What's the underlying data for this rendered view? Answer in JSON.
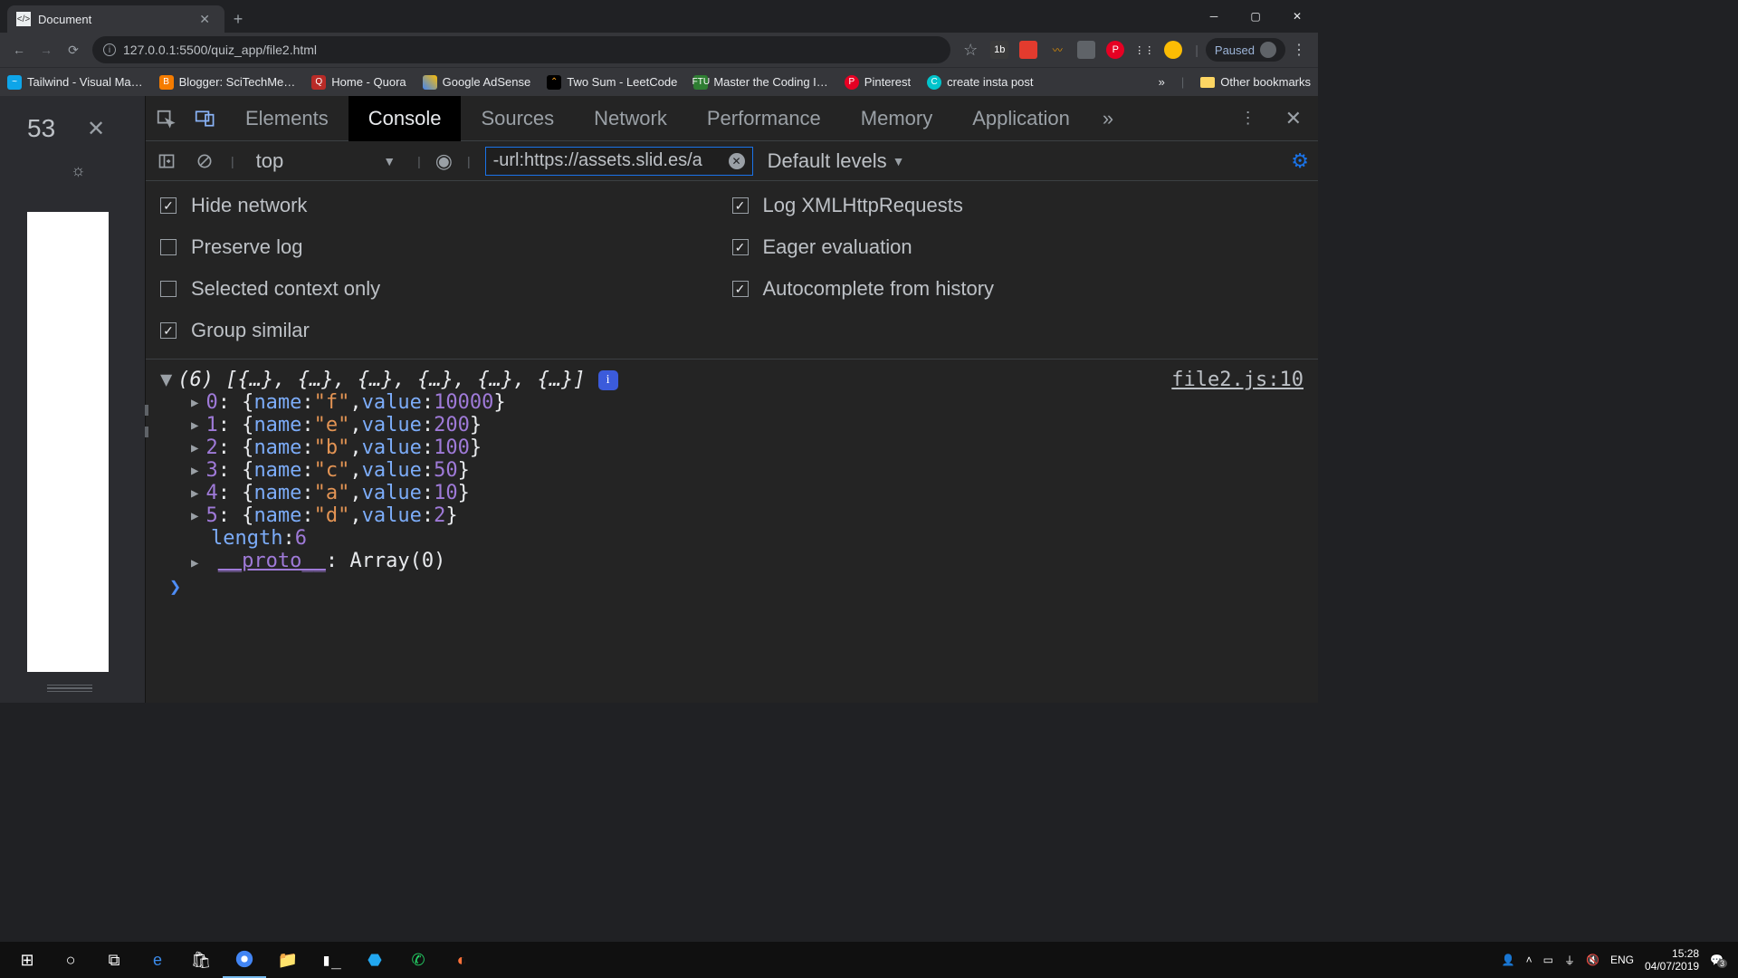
{
  "browser": {
    "tab_title": "Document",
    "url_display": "127.0.0.1:5500/quiz_app/file2.html",
    "paused_label": "Paused"
  },
  "bookmarks": {
    "b0": "Tailwind - Visual Ma…",
    "b1": "Blogger: SciTechMe…",
    "b2": "Home - Quora",
    "b3": "Google AdSense",
    "b4": "Two Sum - LeetCode",
    "b5": "Master the Coding I…",
    "b6": "Pinterest",
    "b7": "create insta post",
    "more": "»",
    "other": "Other bookmarks"
  },
  "page_pane": {
    "count": "53"
  },
  "devtools": {
    "tabs": {
      "t0": "Elements",
      "t1": "Console",
      "t2": "Sources",
      "t3": "Network",
      "t4": "Performance",
      "t5": "Memory",
      "t6": "Application"
    },
    "toolbar": {
      "context": "top",
      "filter": "-url:https://assets.slid.es/a",
      "levels": "Default levels"
    },
    "settings": {
      "hide_network": "Hide network",
      "preserve_log": "Preserve log",
      "selected_context": "Selected context only",
      "group_similar": "Group similar",
      "log_xhr": "Log XMLHttpRequests",
      "eager_eval": "Eager evaluation",
      "autocomplete": "Autocomplete from history"
    },
    "output": {
      "summary": "(6) [{…}, {…}, {…}, {…}, {…}, {…}]",
      "source_link": "file2.js:10",
      "items": [
        {
          "idx": "0",
          "name": "f",
          "value": "10000"
        },
        {
          "idx": "1",
          "name": "e",
          "value": "200"
        },
        {
          "idx": "2",
          "name": "b",
          "value": "100"
        },
        {
          "idx": "3",
          "name": "c",
          "value": "50"
        },
        {
          "idx": "4",
          "name": "a",
          "value": "10"
        },
        {
          "idx": "5",
          "name": "d",
          "value": "2"
        }
      ],
      "length_label": "length",
      "length_value": "6",
      "proto_label": "__proto__",
      "proto_value": "Array(0)"
    }
  },
  "taskbar": {
    "lang": "ENG",
    "time": "15:28",
    "date": "04/07/2019",
    "notif_count": "3"
  }
}
